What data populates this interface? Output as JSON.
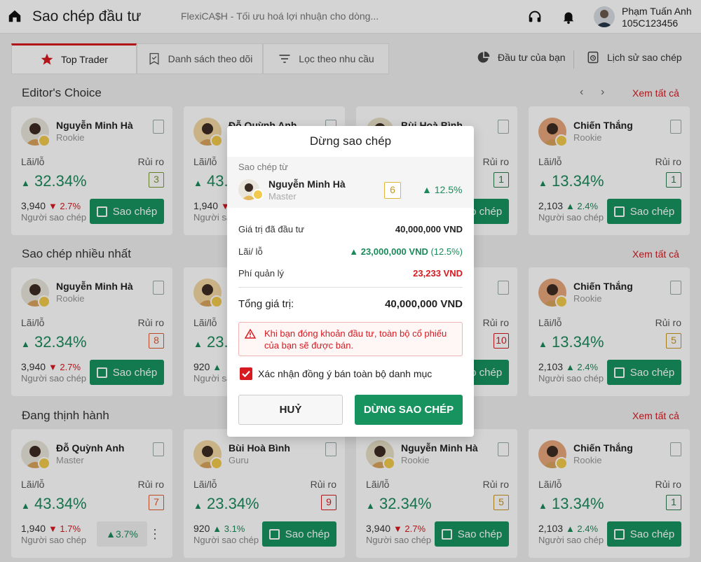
{
  "header": {
    "title": "Sao chép đầu tư",
    "ticker": "FlexiCA$H - Tối ưu hoá lợi nhuận cho dòng...",
    "user_name": "Phạm Tuấn Anh",
    "user_id": "105C123456"
  },
  "tabs": [
    {
      "label": "Top Trader",
      "icon": "star-icon"
    },
    {
      "label": "Danh sách theo dõi",
      "icon": "bookmark-check-icon"
    },
    {
      "label": "Lọc theo nhu cầu",
      "icon": "filter-icon"
    }
  ],
  "links": {
    "my_investment": "Đầu tư của bạn",
    "copy_history": "Lịch sử sao chép"
  },
  "labels": {
    "pl": "Lãi/lỗ",
    "risk": "Rủi ro",
    "copiers": "Người sao chép",
    "copy_button": "Sao chép",
    "see_all": "Xem tất cả",
    "prev": "‹",
    "next": "›"
  },
  "sections": [
    {
      "title": "Editor's Choice",
      "cards": [
        {
          "name": "Nguyễn Minh Hà",
          "level": "Rookie",
          "pl": "32.34%",
          "risk": "3",
          "risk_color": "#7a9b2e",
          "copiers": "3,940",
          "copiers_change": "2.7%",
          "change_dir": "down"
        },
        {
          "name": "Đỗ Quỳnh Anh",
          "level": "",
          "pl": "43.",
          "risk": "",
          "copiers": "1,940",
          "copiers_change": "",
          "change_dir": "down"
        },
        {
          "name": "Bùi Hoà Bình",
          "level": "",
          "pl": "",
          "risk": "1",
          "risk_color": "#2b7a4b",
          "copiers": "",
          "copiers_change": "",
          "change_dir": "up"
        },
        {
          "name": "Chiến Thắng",
          "level": "Rookie",
          "pl": "13.34%",
          "risk": "1",
          "risk_color": "#2b7a4b",
          "copiers": "2,103",
          "copiers_change": "2.4%",
          "change_dir": "up"
        }
      ]
    },
    {
      "title": "Sao chép nhiều nhất",
      "cards": [
        {
          "name": "Nguyễn Minh Hà",
          "level": "Rookie",
          "pl": "32.34%",
          "risk": "8",
          "risk_color": "#e05a2e",
          "copiers": "3,940",
          "copiers_change": "2.7%",
          "change_dir": "down"
        },
        {
          "name": "",
          "level": "",
          "pl": "23.",
          "risk": "",
          "copiers": "920",
          "copiers_change": "",
          "change_dir": "up"
        },
        {
          "name": "",
          "level": "",
          "pl": "",
          "risk": "10",
          "risk_color": "#d71920",
          "copiers": "",
          "copiers_change": "",
          "change_dir": "up"
        },
        {
          "name": "Chiến Thắng",
          "level": "Rookie",
          "pl": "13.34%",
          "risk": "5",
          "risk_color": "#c89420",
          "copiers": "2,103",
          "copiers_change": "2.4%",
          "change_dir": "up"
        }
      ]
    },
    {
      "title": "Đang thịnh hành",
      "cards": [
        {
          "name": "Đỗ Quỳnh Anh",
          "level": "Master",
          "pl": "43.34%",
          "risk": "7",
          "risk_color": "#e05a2e",
          "copiers": "1,940",
          "copiers_change": "1.7%",
          "change_dir": "down",
          "mini": "3.7%"
        },
        {
          "name": "Bùi Hoà Bình",
          "level": "Guru",
          "pl": "23.34%",
          "risk": "9",
          "risk_color": "#d71920",
          "copiers": "920",
          "copiers_change": "3.1%",
          "change_dir": "up"
        },
        {
          "name": "Nguyễn Minh Hà",
          "level": "Rookie",
          "pl": "32.34%",
          "risk": "5",
          "risk_color": "#c89420",
          "copiers": "3,940",
          "copiers_change": "2.7%",
          "change_dir": "down"
        },
        {
          "name": "Chiến Thắng",
          "level": "Rookie",
          "pl": "13.34%",
          "risk": "1",
          "risk_color": "#2b7a4b",
          "copiers": "2,103",
          "copiers_change": "2.4%",
          "change_dir": "up"
        }
      ]
    }
  ],
  "modal": {
    "title": "Dừng sao chép",
    "copy_from_label": "Sao chép từ",
    "trader_name": "Nguyễn Minh Hà",
    "trader_level": "Master",
    "trader_risk": "6",
    "trader_pct": "12.5%",
    "invested_label": "Giá trị đã đầu tư",
    "invested_value": "40,000,000 VND",
    "pl_label": "Lãi/ lỗ",
    "pl_value": "23,000,000 VND",
    "pl_pct": "(12.5%)",
    "fee_label": "Phí quản lý",
    "fee_value": "23,233 VND",
    "total_label": "Tổng giá trị:",
    "total_value": "40,000,000 VND",
    "warning": "Khi bạn đóng khoản đầu tư, toàn bộ cổ phiếu của bạn sẽ được bán.",
    "confirm_label": "Xác nhận đồng ý bán toàn bộ danh mục",
    "cancel_label": "HUỶ",
    "stop_label": "DỪNG SAO CHÉP"
  }
}
